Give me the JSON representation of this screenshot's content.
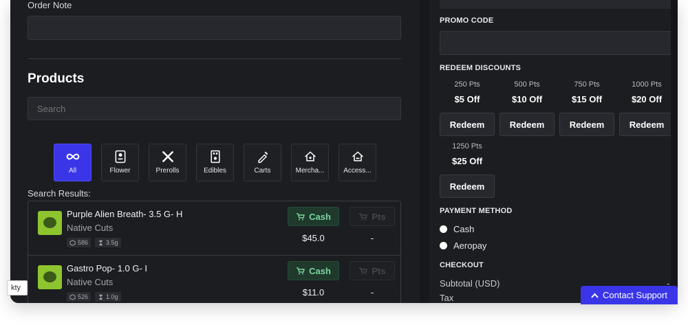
{
  "order": {
    "note_label": "Order Note"
  },
  "products": {
    "title": "Products",
    "search_placeholder": "Search",
    "categories": [
      {
        "label": "All",
        "icon": "infinity-icon",
        "active": true
      },
      {
        "label": "Flower",
        "icon": "flower-icon",
        "active": false
      },
      {
        "label": "Prerolls",
        "icon": "preroll-icon",
        "active": false
      },
      {
        "label": "Edibles",
        "icon": "edibles-icon",
        "active": false
      },
      {
        "label": "Carts",
        "icon": "cart-vape-icon",
        "active": false
      },
      {
        "label": "Mercha...",
        "icon": "merch-icon",
        "active": false
      },
      {
        "label": "Access...",
        "icon": "accessories-icon",
        "active": false
      }
    ],
    "results_label": "Search Results:",
    "items": [
      {
        "name": "Purple Alien Breath- 3.5 G- H",
        "brand": "Native Cuts",
        "stock": "586",
        "weight": "3.5g",
        "cash_label": "Cash",
        "pts_label": "Pts",
        "price": "$45.0",
        "pts_value": "-"
      },
      {
        "name": "Gastro Pop- 1.0 G- I",
        "brand": "Native Cuts",
        "stock": "526",
        "weight": "1.0g",
        "cash_label": "Cash",
        "pts_label": "Pts",
        "price": "$11.0",
        "pts_value": "-"
      }
    ]
  },
  "side_tab": "kty",
  "promo": {
    "heading": "PROMO CODE"
  },
  "discounts": {
    "heading": "REDEEM DISCOUNTS",
    "options": [
      {
        "pts": "250 Pts",
        "off": "$5 Off",
        "button": "Redeem"
      },
      {
        "pts": "500 Pts",
        "off": "$10 Off",
        "button": "Redeem"
      },
      {
        "pts": "750 Pts",
        "off": "$15 Off",
        "button": "Redeem"
      },
      {
        "pts": "1000 Pts",
        "off": "$20 Off",
        "button": "Redeem"
      },
      {
        "pts": "1250 Pts",
        "off": "$25 Off",
        "button": "Redeem"
      }
    ]
  },
  "payment": {
    "heading": "PAYMENT METHOD",
    "options": [
      "Cash",
      "Aeropay"
    ]
  },
  "checkout": {
    "heading": "CHECKOUT",
    "subtotal_label": "Subtotal (USD)",
    "subtotal_value": "-",
    "tax_label": "Tax"
  },
  "support": {
    "label": "Contact Support"
  },
  "colors": {
    "accent": "#3a36e8",
    "panel": "#1b1d21",
    "cash_green": "#7cd3a0"
  }
}
